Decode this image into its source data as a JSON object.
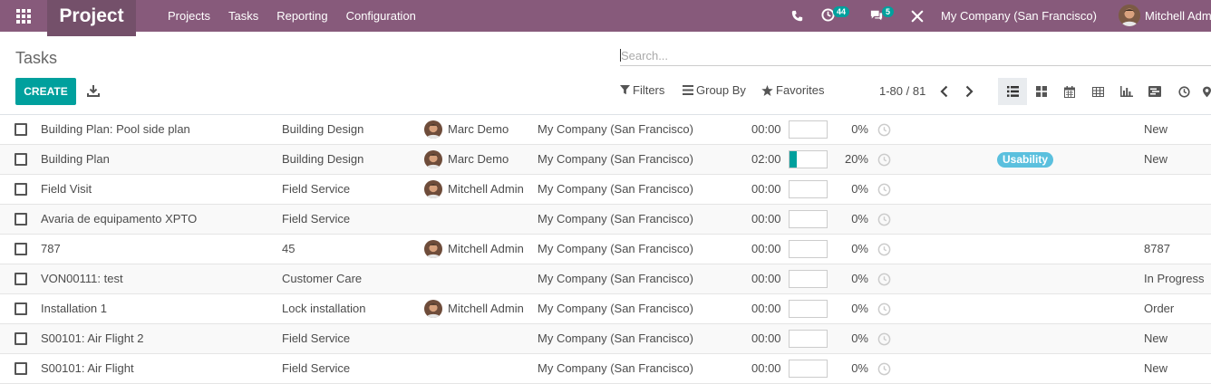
{
  "navbar": {
    "app_title": "Project",
    "menu": [
      "Projects",
      "Tasks",
      "Reporting",
      "Configuration"
    ],
    "activity_count": "44",
    "message_count": "5",
    "company": "My Company (San Francisco)",
    "user": "Mitchell Adm",
    "brand_color": "#875a7b"
  },
  "control": {
    "breadcrumb": "Tasks",
    "search_placeholder": "Search...",
    "create_label": "CREATE",
    "filters_label": "Filters",
    "groupby_label": "Group By",
    "favorites_label": "Favorites",
    "pager": "1-80 / 81",
    "views": [
      "list-view-icon",
      "kanban-view-icon",
      "calendar-view-icon",
      "pivot-view-icon",
      "graph-view-icon",
      "gantt-view-icon",
      "activity-view-icon",
      "map-view-icon"
    ],
    "accent_color": "#00a09d"
  },
  "tasks": [
    {
      "name": "Building Plan: Pool side plan",
      "project": "Building Design",
      "assignee": "Marc Demo",
      "company": "My Company (San Francisco)",
      "hours": "00:00",
      "progress": 0,
      "progress_label": "0%",
      "tag": "",
      "stage": "New"
    },
    {
      "name": "Building Plan",
      "project": "Building Design",
      "assignee": "Marc Demo",
      "company": "My Company (San Francisco)",
      "hours": "02:00",
      "progress": 20,
      "progress_label": "20%",
      "tag": "Usability",
      "stage": "New"
    },
    {
      "name": "Field Visit",
      "project": "Field Service",
      "assignee": "Mitchell Admin",
      "company": "My Company (San Francisco)",
      "hours": "00:00",
      "progress": 0,
      "progress_label": "0%",
      "tag": "",
      "stage": ""
    },
    {
      "name": "Avaria de equipamento XPTO",
      "project": "Field Service",
      "assignee": "",
      "company": "My Company (San Francisco)",
      "hours": "00:00",
      "progress": 0,
      "progress_label": "0%",
      "tag": "",
      "stage": ""
    },
    {
      "name": "787",
      "project": "45",
      "assignee": "Mitchell Admin",
      "company": "My Company (San Francisco)",
      "hours": "00:00",
      "progress": 0,
      "progress_label": "0%",
      "tag": "",
      "stage": "8787"
    },
    {
      "name": "VON00111: test",
      "project": "Customer Care",
      "assignee": "",
      "company": "My Company (San Francisco)",
      "hours": "00:00",
      "progress": 0,
      "progress_label": "0%",
      "tag": "",
      "stage": "In Progress"
    },
    {
      "name": "Installation 1",
      "project": "Lock installation",
      "assignee": "Mitchell Admin",
      "company": "My Company (San Francisco)",
      "hours": "00:00",
      "progress": 0,
      "progress_label": "0%",
      "tag": "",
      "stage": "Order"
    },
    {
      "name": "S00101: Air Flight 2",
      "project": "Field Service",
      "assignee": "",
      "company": "My Company (San Francisco)",
      "hours": "00:00",
      "progress": 0,
      "progress_label": "0%",
      "tag": "",
      "stage": "New"
    },
    {
      "name": "S00101: Air Flight",
      "project": "Field Service",
      "assignee": "",
      "company": "My Company (San Francisco)",
      "hours": "00:00",
      "progress": 0,
      "progress_label": "0%",
      "tag": "",
      "stage": "New"
    }
  ]
}
